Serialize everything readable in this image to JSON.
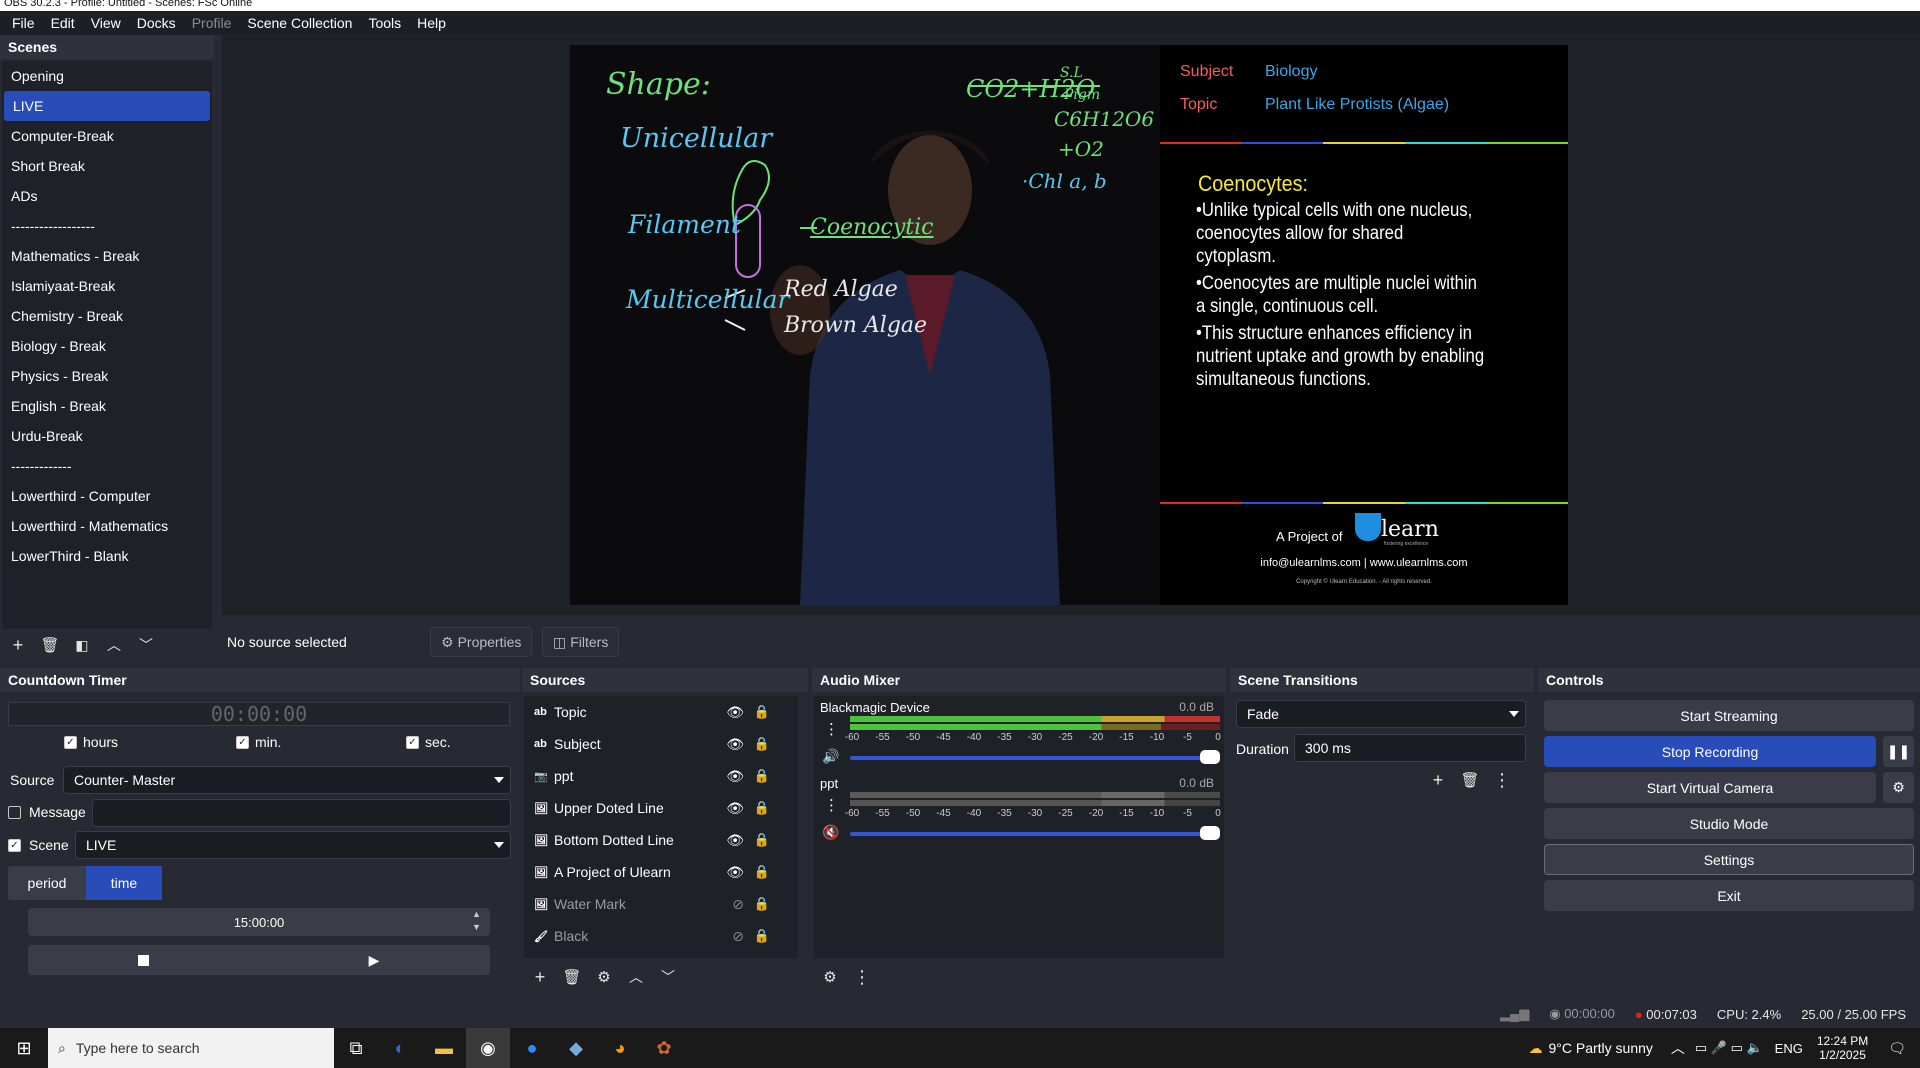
{
  "window": {
    "title": "OBS 30.2.3 - Profile: Untitled - Scenes: FSc Online"
  },
  "menu": [
    "File",
    "Edit",
    "View",
    "Docks",
    "Profile",
    "Scene Collection",
    "Tools",
    "Help"
  ],
  "scenes": {
    "title": "Scenes",
    "items": [
      "Opening",
      "LIVE",
      "Computer-Break",
      "Short Break",
      "ADs",
      "------------------",
      "Mathematics  - Break",
      "Islamiyaat-Break",
      "Chemistry  - Break",
      "Biology  - Break",
      "Physics  - Break",
      "English - Break",
      "Urdu-Break",
      "-------------",
      "Lowerthird - Computer",
      "Lowerthird - Mathematics",
      "LowerThird - Blank"
    ],
    "active_index": 1
  },
  "preview": {
    "board": {
      "shape": "Shape:",
      "unicellular": "Unicellular",
      "filament": "Filament",
      "coenocytic": "Coenocytic",
      "multicellular": "Multicellular",
      "red_algae": "Red Algae",
      "brown_algae": "Brown Algae",
      "formula1": "CO2+H2O",
      "formula_sl": "S.L",
      "formula_pigm": "Pigm",
      "formula2": "C6H12O6",
      "formula3": "+O2",
      "formula4": "·Chl a, b"
    },
    "slide": {
      "subject_label": "Subject",
      "subject_value": "Biology",
      "topic_label": "Topic",
      "topic_value": "Plant Like Protists (Algae)",
      "heading": "Coenocytes:",
      "bullets": [
        "•Unlike typical cells with one nucleus, coenocytes allow for shared cytoplasm.",
        "•Coenocytes are multiple nuclei within a single, continuous cell.",
        "•This structure enhances efficiency in nutrient uptake and growth by enabling simultaneous functions."
      ],
      "project_of": "A Project of",
      "brand": "learn",
      "brand_tag": "fostering excellence",
      "contact": "info@ulearnlms.com | www.ulearnlms.com",
      "copyright": "Copyright © Ulearn Education. - All rights reserved."
    }
  },
  "source_bar": {
    "status": "No source selected",
    "properties": "Properties",
    "filters": "Filters"
  },
  "countdown": {
    "title": "Countdown Timer",
    "display": "00:00:00",
    "hours_label": "hours",
    "min_label": "min.",
    "sec_label": "sec.",
    "source_label": "Source",
    "source_value": "Counter- Master",
    "message_label": "Message",
    "message_value": "",
    "scene_label": "Scene",
    "scene_value": "LIVE",
    "tab_period": "period",
    "tab_time": "time",
    "time_value": "15:00:00"
  },
  "sources": {
    "title": "Sources",
    "items": [
      {
        "name": "Topic",
        "icon": "text-icon",
        "visible": true
      },
      {
        "name": "Subject",
        "icon": "text-icon",
        "visible": true
      },
      {
        "name": "ppt",
        "icon": "camera-icon",
        "visible": true
      },
      {
        "name": "Upper Doted Line",
        "icon": "image-icon",
        "visible": true
      },
      {
        "name": "Bottom Dotted Line",
        "icon": "image-icon",
        "visible": true
      },
      {
        "name": "A Project of Ulearn",
        "icon": "image-icon",
        "visible": true
      },
      {
        "name": "Water Mark",
        "icon": "image-icon",
        "visible": false
      },
      {
        "name": "Black",
        "icon": "brush-icon",
        "visible": false
      }
    ]
  },
  "mixer": {
    "title": "Audio Mixer",
    "scale": [
      "-60",
      "-55",
      "-50",
      "-45",
      "-40",
      "-35",
      "-30",
      "-25",
      "-20",
      "-15",
      "-10",
      "-5",
      "0"
    ],
    "channels": [
      {
        "name": "Blackmagic Device",
        "db": "0.0 dB",
        "muted": false
      },
      {
        "name": "ppt",
        "db": "0.0 dB",
        "muted": true
      }
    ]
  },
  "transitions": {
    "title": "Scene Transitions",
    "type": "Fade",
    "duration_label": "Duration",
    "duration_value": "300 ms"
  },
  "controls": {
    "title": "Controls",
    "start_streaming": "Start Streaming",
    "stop_recording": "Stop Recording",
    "start_virtual_camera": "Start Virtual Camera",
    "studio_mode": "Studio Mode",
    "settings": "Settings",
    "exit": "Exit"
  },
  "status": {
    "stream_time": "00:00:00",
    "rec_time": "00:07:03",
    "cpu": "CPU: 2.4%",
    "fps": "25.00 / 25.00 FPS"
  },
  "taskbar": {
    "search_placeholder": "Type here to search",
    "weather": "9°C  Partly sunny",
    "lang": "ENG",
    "time": "12:24 PM",
    "date": "1/2/2025"
  },
  "colors": {
    "accent": "#284cb8",
    "chalk_green": "#6fe07a",
    "chalk_blue": "#59c7f2",
    "slide_yellow": "#f5ea3c",
    "subject_red": "#f0605a",
    "rec_red": "#e32020"
  }
}
